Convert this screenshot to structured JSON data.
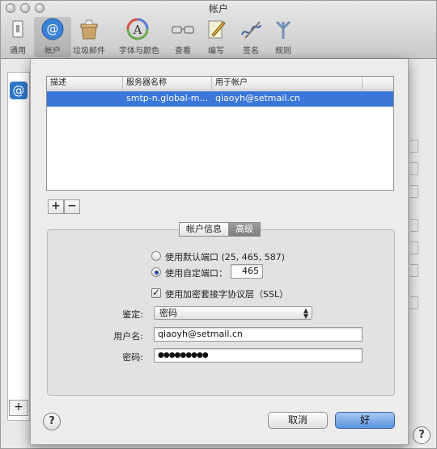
{
  "window": {
    "title": "帐户"
  },
  "toolbar": {
    "items": [
      {
        "label": "通用",
        "icon": "general-icon"
      },
      {
        "label": "帐户",
        "icon": "at-icon",
        "selected": true
      },
      {
        "label": "垃圾邮件",
        "icon": "junk-mail-icon"
      },
      {
        "label": "字体与颜色",
        "icon": "fonts-colors-icon"
      },
      {
        "label": "查看",
        "icon": "view-glasses-icon"
      },
      {
        "label": "编写",
        "icon": "compose-icon"
      },
      {
        "label": "签名",
        "icon": "signature-icon"
      },
      {
        "label": "规则",
        "icon": "rules-icon"
      }
    ]
  },
  "smtp_table": {
    "columns": [
      "描述",
      "服务器名称",
      "用于帐户"
    ],
    "rows": [
      {
        "description": "",
        "server": "smtp-n.global-m...",
        "account": "qiaoyh@setmail.cn",
        "selected": true
      }
    ],
    "add_label": "+",
    "remove_label": "−"
  },
  "tabs": [
    {
      "label": "帐户信息",
      "active": false
    },
    {
      "label": "高级",
      "active": true
    }
  ],
  "advanced": {
    "default_port_label": "使用默认端口 (25, 465, 587)",
    "custom_port_label": "使用自定端口：",
    "custom_port_value": "465",
    "port_mode": "custom",
    "ssl_label": "使用加密套接字协议层（SSL）",
    "ssl_checked": true,
    "auth_label": "鉴定:",
    "auth_value": "密码",
    "username_label": "用户名:",
    "username_value": "qiaoyh@setmail.cn",
    "password_label": "密码:",
    "password_value": "●●●●●●●●●"
  },
  "buttons": {
    "help": "?",
    "cancel": "取消",
    "ok": "好"
  },
  "background": {
    "add_label": "+",
    "help": "?"
  },
  "colors": {
    "selection": "#3a77d8",
    "ok_button": "#5a93e0"
  }
}
